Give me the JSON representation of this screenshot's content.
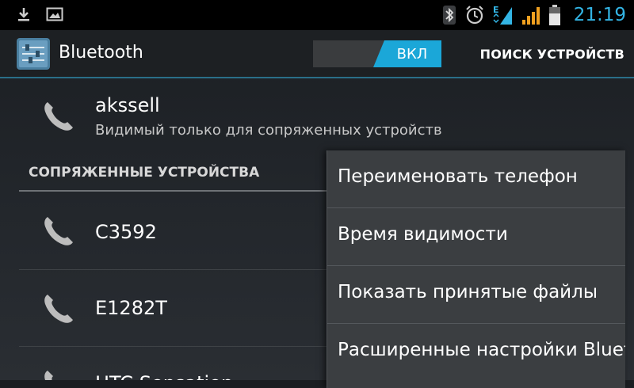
{
  "status_bar": {
    "time": "21:19",
    "signal_network": "E",
    "left_icons": [
      "download-icon",
      "image-icon"
    ],
    "right_icons": [
      "bluetooth-icon",
      "alarm-icon",
      "data-signal-icon",
      "signal-icon",
      "battery-icon"
    ]
  },
  "action_bar": {
    "title": "Bluetooth",
    "toggle_label": "ВКЛ",
    "search_label": "ПОИСК УСТРОЙСТВ",
    "accent_color": "#33b5e5"
  },
  "own_device": {
    "name": "akssell",
    "visibility": "Видимый только для сопряженных устройств"
  },
  "paired_section": {
    "header": "СОПРЯЖЕННЫЕ УСТРОЙСТВА",
    "devices": [
      {
        "name": "C3592"
      },
      {
        "name": "E1282T"
      },
      {
        "name": "HTC Sensation"
      }
    ]
  },
  "overflow_menu": {
    "items": [
      {
        "label": "Переименовать телефон"
      },
      {
        "label": "Время видимости"
      },
      {
        "label": "Показать принятые файлы"
      },
      {
        "label": "Расширенные настройки Bluetooth"
      }
    ]
  }
}
